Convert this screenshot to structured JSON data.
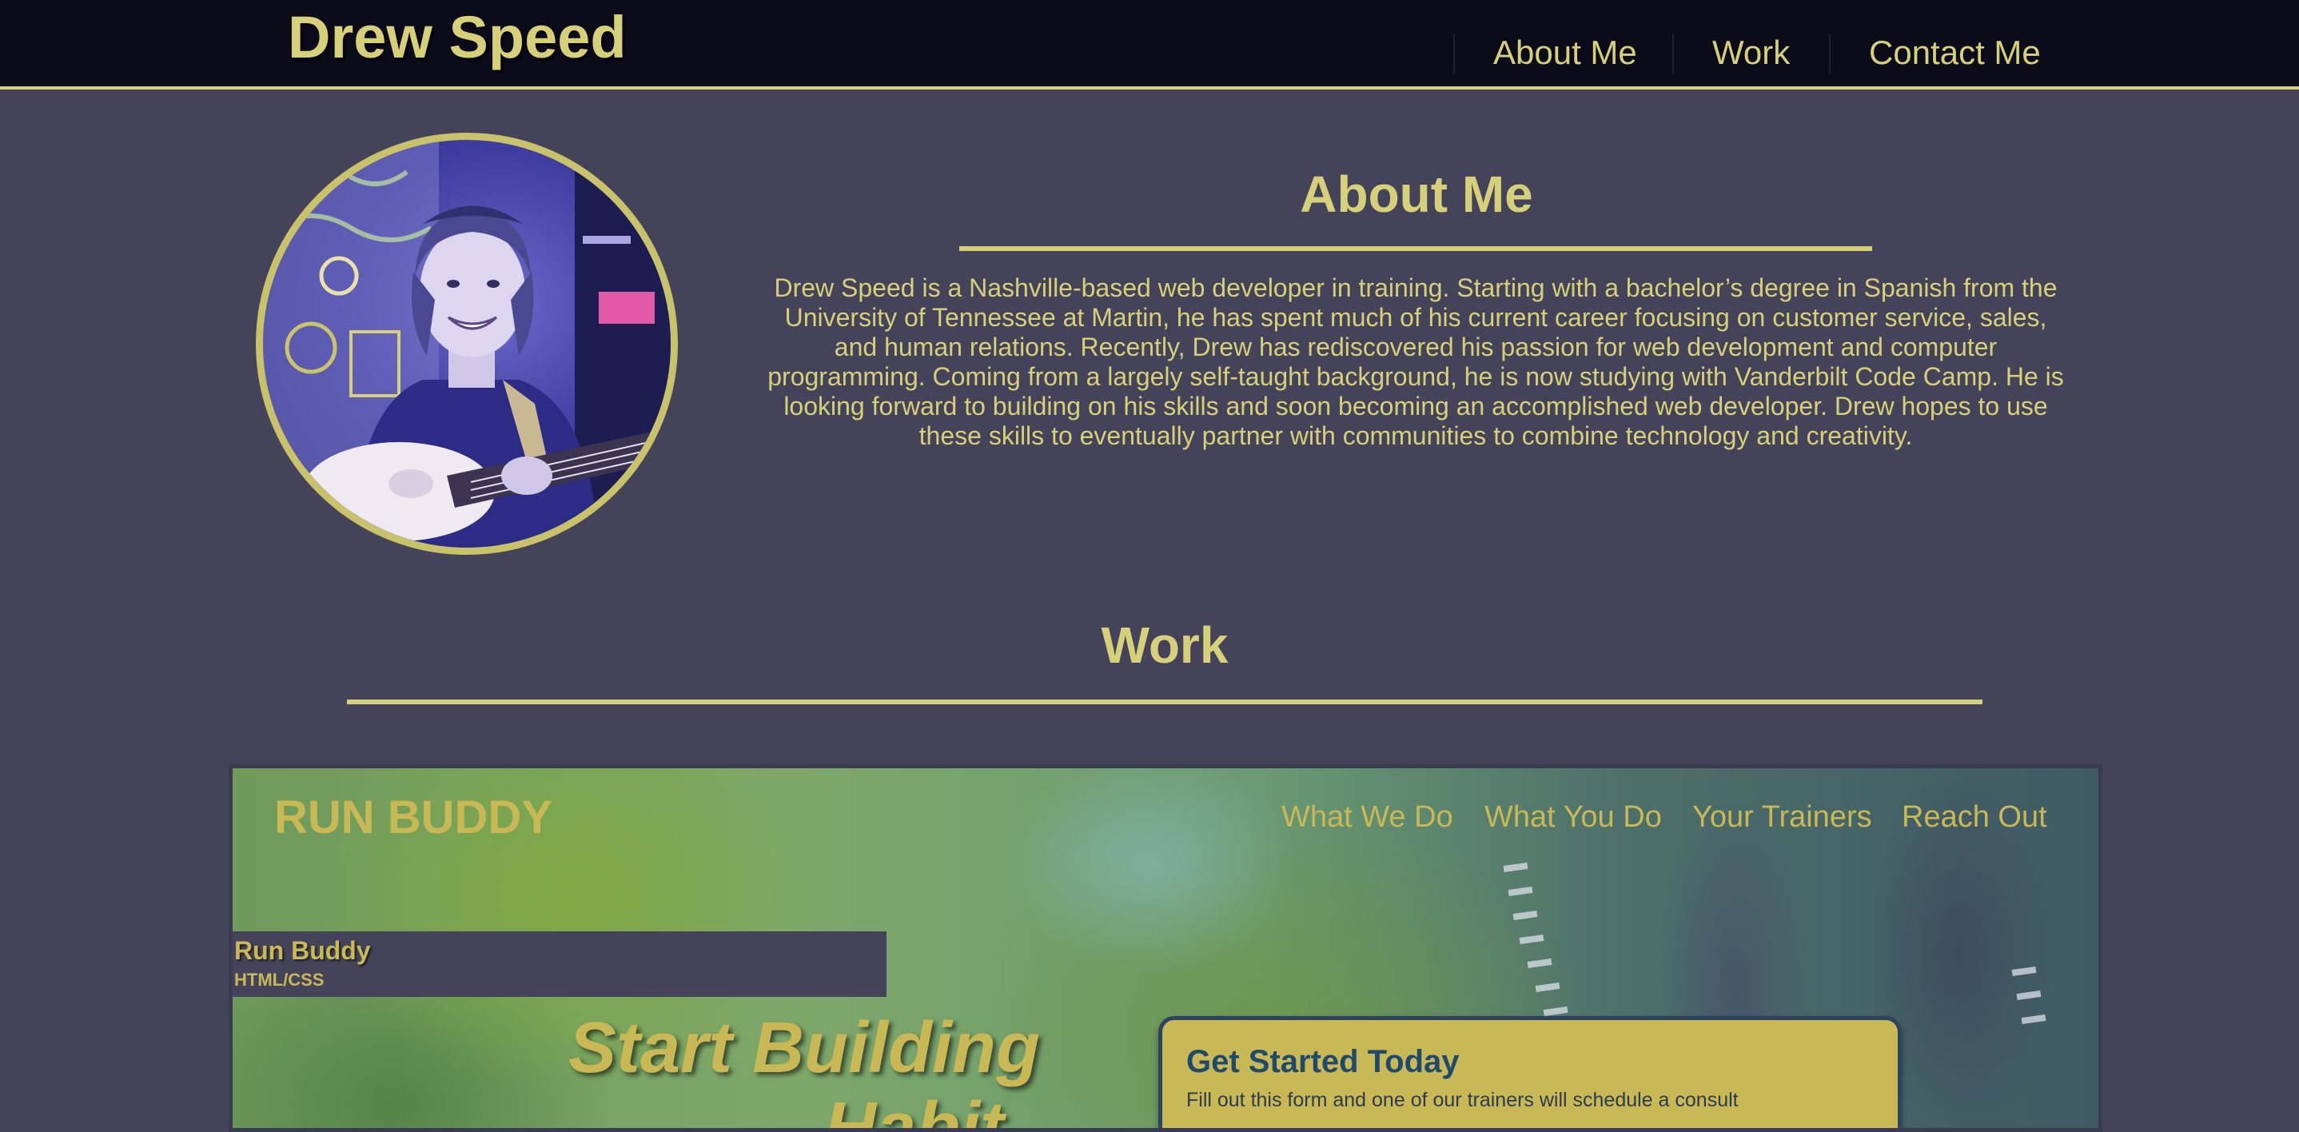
{
  "header": {
    "title": "Drew Speed",
    "nav": [
      "About Me",
      "Work",
      "Contact Me"
    ]
  },
  "about": {
    "heading": "About Me",
    "portrait_icon": "portrait-photo",
    "body": "Drew Speed is a Nashville-based web developer in training. Starting with a bachelor’s degree in Spanish from the University of Tennessee at Martin, he has spent much of his current career focusing on customer service, sales, and human relations. Recently, Drew has rediscovered his passion for web development and computer programming. Coming from a largely self-taught background, he is now studying with Vanderbilt Code Camp. He is looking forward to building on his skills and soon becoming an accomplished web developer. Drew hopes to use these skills to eventually partner with communities to combine technology and creativity."
  },
  "work": {
    "heading": "Work",
    "projects": [
      {
        "name": "Run Buddy",
        "tech": "HTML/CSS",
        "preview": {
          "logo": "RUN BUDDY",
          "nav": [
            "What We Do",
            "What You Do",
            "Your Trainers",
            "Reach Out"
          ],
          "hero_line1": "Start Building",
          "hero_line2": "Habit",
          "form_title": "Get Started Today",
          "form_subtitle": "Fill out this form and one of our trainers will schedule a consult"
        }
      }
    ]
  },
  "colors": {
    "accent": "#d6d07a",
    "background": "#44435a",
    "header_bg": "#0b0b1a"
  }
}
